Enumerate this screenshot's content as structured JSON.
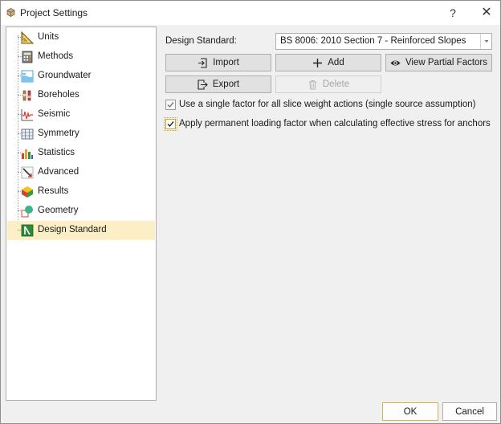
{
  "window": {
    "title": "Project Settings",
    "help_glyph": "?",
    "close_glyph": "✕"
  },
  "sidebar": {
    "items": [
      {
        "label": "Units",
        "icon": "ruler-triangle-icon"
      },
      {
        "label": "Methods",
        "icon": "calculator-icon"
      },
      {
        "label": "Groundwater",
        "icon": "groundwater-icon"
      },
      {
        "label": "Boreholes",
        "icon": "borehole-icon"
      },
      {
        "label": "Seismic",
        "icon": "seismic-wave-icon"
      },
      {
        "label": "Symmetry",
        "icon": "symmetry-grid-icon"
      },
      {
        "label": "Statistics",
        "icon": "statistics-bars-icon"
      },
      {
        "label": "Advanced",
        "icon": "advanced-tools-icon"
      },
      {
        "label": "Results",
        "icon": "results-cube-icon"
      },
      {
        "label": "Geometry",
        "icon": "geometry-shapes-icon"
      },
      {
        "label": "Design Standard",
        "icon": "design-standard-icon"
      }
    ],
    "selected_index": 10
  },
  "main": {
    "design_standard_label": "Design Standard:",
    "design_standard_value": "BS 8006: 2010 Section 7 - Reinforced Slopes",
    "buttons": {
      "import": "Import",
      "add": "Add",
      "view_partial_factors": "View Partial Factors",
      "export": "Export",
      "delete": "Delete"
    },
    "checkboxes": [
      {
        "label": "Use a single factor for all slice weight actions (single source assumption)",
        "checked": true,
        "enabled": false
      },
      {
        "label": "Apply permanent loading factor when calculating effective stress for anchors",
        "checked": true,
        "enabled": true
      }
    ]
  },
  "footer": {
    "ok": "OK",
    "cancel": "Cancel"
  },
  "colors": {
    "selection": "#fcefc6",
    "ok_border": "#d3b25c"
  }
}
